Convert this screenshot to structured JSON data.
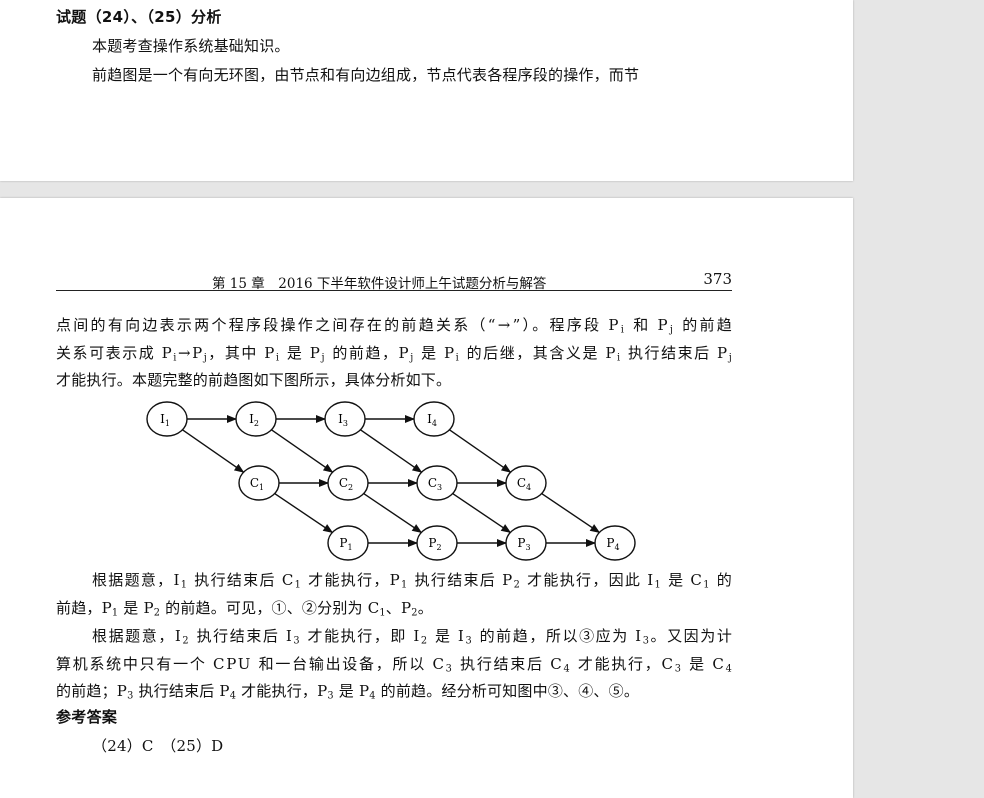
{
  "top_page": {
    "heading": "试题（24）、（25）分析",
    "para1": "本题考查操作系统基础知识。",
    "para2": "前趋图是一个有向无环图，由节点和有向边组成，节点代表各程序段的操作，而节"
  },
  "bottom_page": {
    "running_head": "第 15 章　2016 下半年软件设计师上午试题分析与解答",
    "page_number": "373",
    "line1": [
      {
        "t": "点间的有向边表示两个程序段操作之间存在的前趋关系（“→”）。程序段 P"
      },
      {
        "s": "i"
      },
      {
        "t": " 和 P"
      },
      {
        "s": "j"
      },
      {
        "t": " 的前趋"
      }
    ],
    "line2": [
      {
        "t": "关系可表示成 P"
      },
      {
        "s": "i"
      },
      {
        "t": "→P"
      },
      {
        "s": "j"
      },
      {
        "t": "，其中 P"
      },
      {
        "s": "i"
      },
      {
        "t": " 是 P"
      },
      {
        "s": "j"
      },
      {
        "t": " 的前趋，P"
      },
      {
        "s": "j"
      },
      {
        "t": " 是 P"
      },
      {
        "s": "i"
      },
      {
        "t": " 的后继，其含义是 P"
      },
      {
        "s": "i"
      },
      {
        "t": " 执行结束后 P"
      },
      {
        "s": "j"
      }
    ],
    "line3": "才能执行。本题完整的前趋图如下图所示，具体分析如下。",
    "line4": [
      {
        "t": "根据题意，I"
      },
      {
        "s": "1"
      },
      {
        "t": " 执行结束后 C"
      },
      {
        "s": "1"
      },
      {
        "t": " 才能执行，P"
      },
      {
        "s": "1"
      },
      {
        "t": " 执行结束后 P"
      },
      {
        "s": "2"
      },
      {
        "t": " 才能执行，因此 I"
      },
      {
        "s": "1"
      },
      {
        "t": " 是 C"
      },
      {
        "s": "1"
      },
      {
        "t": " 的"
      }
    ],
    "line5": [
      {
        "t": "前趋，P"
      },
      {
        "s": "1"
      },
      {
        "t": " 是 P"
      },
      {
        "s": "2"
      },
      {
        "t": " 的前趋。可见，①、②分别为 C"
      },
      {
        "s": "1"
      },
      {
        "t": "、P"
      },
      {
        "s": "2"
      },
      {
        "t": "。"
      }
    ],
    "line6": [
      {
        "t": "根据题意，I"
      },
      {
        "s": "2"
      },
      {
        "t": " 执行结束后 I"
      },
      {
        "s": "3"
      },
      {
        "t": " 才能执行，即 I"
      },
      {
        "s": "2"
      },
      {
        "t": " 是 I"
      },
      {
        "s": "3"
      },
      {
        "t": " 的前趋，所以③应为 I"
      },
      {
        "s": "3"
      },
      {
        "t": "。又因为计"
      }
    ],
    "line7": [
      {
        "t": "算机系统中只有一个 CPU 和一台输出设备，所以 C"
      },
      {
        "s": "3"
      },
      {
        "t": " 执行结束后 C"
      },
      {
        "s": "4"
      },
      {
        "t": " 才能执行，C"
      },
      {
        "s": "3"
      },
      {
        "t": " 是 C"
      },
      {
        "s": "4"
      }
    ],
    "line8": [
      {
        "t": "的前趋；P"
      },
      {
        "s": "3"
      },
      {
        "t": " 执行结束后 P"
      },
      {
        "s": "4"
      },
      {
        "t": " 才能执行，P"
      },
      {
        "s": "3"
      },
      {
        "t": " 是 P"
      },
      {
        "s": "4"
      },
      {
        "t": " 的前趋。经分析可知图中③、④、⑤。"
      }
    ],
    "answer_heading": "参考答案",
    "answer_text": "（24）C　（25）D"
  },
  "diagram": {
    "nodes": [
      {
        "id": "I1",
        "letter": "I",
        "sub": "1"
      },
      {
        "id": "I2",
        "letter": "I",
        "sub": "2"
      },
      {
        "id": "I3",
        "letter": "I",
        "sub": "3"
      },
      {
        "id": "I4",
        "letter": "I",
        "sub": "4"
      },
      {
        "id": "C1",
        "letter": "C",
        "sub": "1"
      },
      {
        "id": "C2",
        "letter": "C",
        "sub": "2"
      },
      {
        "id": "C3",
        "letter": "C",
        "sub": "3"
      },
      {
        "id": "C4",
        "letter": "C",
        "sub": "4"
      },
      {
        "id": "P1",
        "letter": "P",
        "sub": "1"
      },
      {
        "id": "P2",
        "letter": "P",
        "sub": "2"
      },
      {
        "id": "P3",
        "letter": "P",
        "sub": "3"
      },
      {
        "id": "P4",
        "letter": "P",
        "sub": "4"
      }
    ],
    "edges": [
      [
        "I1",
        "I2"
      ],
      [
        "I2",
        "I3"
      ],
      [
        "I3",
        "I4"
      ],
      [
        "C1",
        "C2"
      ],
      [
        "C2",
        "C3"
      ],
      [
        "C3",
        "C4"
      ],
      [
        "P1",
        "P2"
      ],
      [
        "P2",
        "P3"
      ],
      [
        "P3",
        "P4"
      ],
      [
        "I1",
        "C1"
      ],
      [
        "I2",
        "C2"
      ],
      [
        "I3",
        "C3"
      ],
      [
        "I4",
        "C4"
      ],
      [
        "C1",
        "P1"
      ],
      [
        "C2",
        "P2"
      ],
      [
        "C3",
        "P3"
      ],
      [
        "C4",
        "P4"
      ]
    ]
  }
}
